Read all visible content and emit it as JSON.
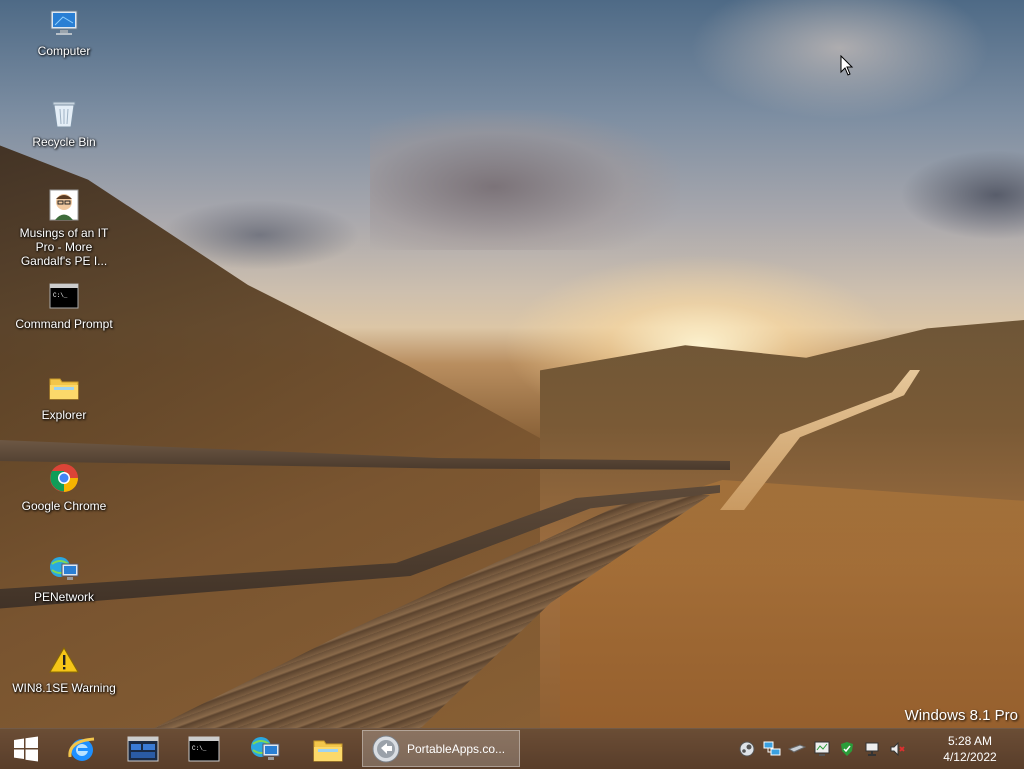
{
  "desktop": {
    "icons": [
      {
        "label": "Computer",
        "icon": "computer-icon"
      },
      {
        "label": "Recycle Bin",
        "icon": "recycle-bin-icon"
      },
      {
        "label": "Musings of an IT Pro - More Gandalf's PE I...",
        "icon": "avatar-shortcut-icon"
      },
      {
        "label": "Command Prompt",
        "icon": "command-prompt-icon"
      },
      {
        "label": "Explorer",
        "icon": "folder-icon"
      },
      {
        "label": "Google Chrome",
        "icon": "chrome-icon"
      },
      {
        "label": "PENetwork",
        "icon": "network-icon"
      },
      {
        "label": "WIN8.1SE Warning",
        "icon": "warning-icon"
      }
    ],
    "watermark": "Windows 8.1 Pro"
  },
  "taskbar": {
    "start": "windows-start-icon",
    "pinned": [
      "internet-explorer-icon",
      "task-manager-icon",
      "command-prompt-icon",
      "network-icon",
      "file-explorer-icon"
    ],
    "active_window": {
      "label": "PortableApps.co...",
      "icon": "portableapps-icon"
    },
    "tray": [
      "steam-like-icon",
      "network-drive-icon",
      "usb-drive-icon",
      "system-monitor-icon",
      "security-shield-icon",
      "network-status-icon",
      "volume-muted-icon"
    ],
    "clock": {
      "time": "5:28 AM",
      "date": "4/12/2022"
    }
  },
  "colors": {
    "taskbar": "#6e5037",
    "accent": "#1e90ff",
    "warning": "#f5c518"
  }
}
